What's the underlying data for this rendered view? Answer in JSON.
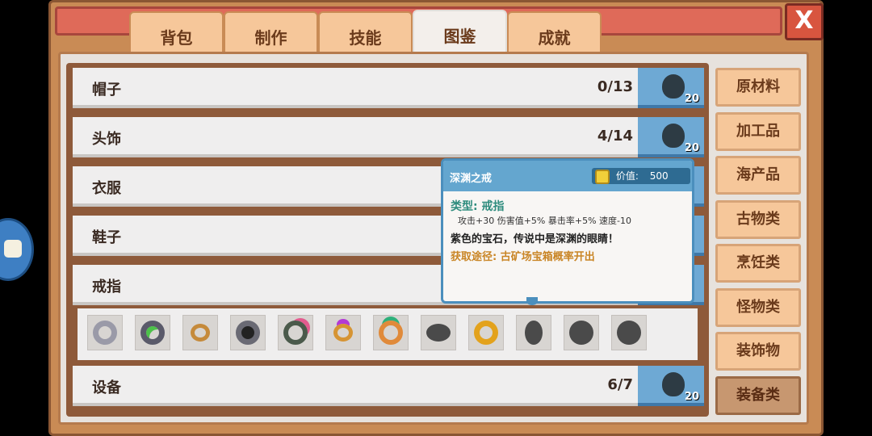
{
  "tabs": [
    {
      "label": "背包",
      "active": false
    },
    {
      "label": "制作",
      "active": false
    },
    {
      "label": "技能",
      "active": false
    },
    {
      "label": "图鉴",
      "active": true
    },
    {
      "label": "成就",
      "active": false
    }
  ],
  "close_label": "X",
  "categories": [
    {
      "label": "帽子",
      "count": "0/13",
      "icon_count": "20"
    },
    {
      "label": "头饰",
      "count": "4/14",
      "icon_count": "20"
    },
    {
      "label": "衣服"
    },
    {
      "label": "鞋子"
    },
    {
      "label": "戒指"
    },
    {
      "label": "设备",
      "count": "6/7",
      "icon_count": "20"
    }
  ],
  "sidebar": [
    {
      "label": "原材料",
      "active": false
    },
    {
      "label": "加工品",
      "active": false
    },
    {
      "label": "海产品",
      "active": false
    },
    {
      "label": "古物类",
      "active": false
    },
    {
      "label": "烹饪类",
      "active": false
    },
    {
      "label": "怪物类",
      "active": false
    },
    {
      "label": "装饰物",
      "active": false
    },
    {
      "label": "装备类",
      "active": true
    }
  ],
  "rings": [
    {
      "icon": "silver-ring-icon",
      "color": "#9a9aa8",
      "discovered": true
    },
    {
      "icon": "emerald-dark-ring-icon",
      "color": "#4cc14a",
      "discovered": true
    },
    {
      "icon": "diamond-ring-icon",
      "color": "#c58a3b",
      "discovered": true
    },
    {
      "icon": "ruby-steel-ring-icon",
      "color": "#c8375a",
      "discovered": true
    },
    {
      "icon": "pink-gem-ring-icon",
      "color": "#e35b8f",
      "discovered": true
    },
    {
      "icon": "amethyst-ring-icon",
      "color": "#b33ad6",
      "discovered": true
    },
    {
      "icon": "jade-crown-ring-icon",
      "color": "#2fb07a",
      "discovered": true
    },
    {
      "icon": "unknown-ring-icon",
      "color": "#4a4a4a",
      "discovered": false
    },
    {
      "icon": "gold-ring-icon",
      "color": "#e3a21c",
      "discovered": true
    },
    {
      "icon": "unknown-ring-icon",
      "color": "#4a4a4a",
      "discovered": false
    },
    {
      "icon": "unknown-ring-icon",
      "color": "#4a4a4a",
      "discovered": false
    },
    {
      "icon": "unknown-ring-icon",
      "color": "#4a4a4a",
      "discovered": false
    }
  ],
  "tooltip": {
    "name": "深渊之戒",
    "value_label": "价值:",
    "value": "500",
    "type": "类型: 戒指",
    "stats": "攻击+30   伤害值+5%   暴击率+5%   速度-10",
    "description": "紫色的宝石，传说中是深渊的眼睛！",
    "source": "获取途径: 古矿场宝箱概率开出"
  }
}
